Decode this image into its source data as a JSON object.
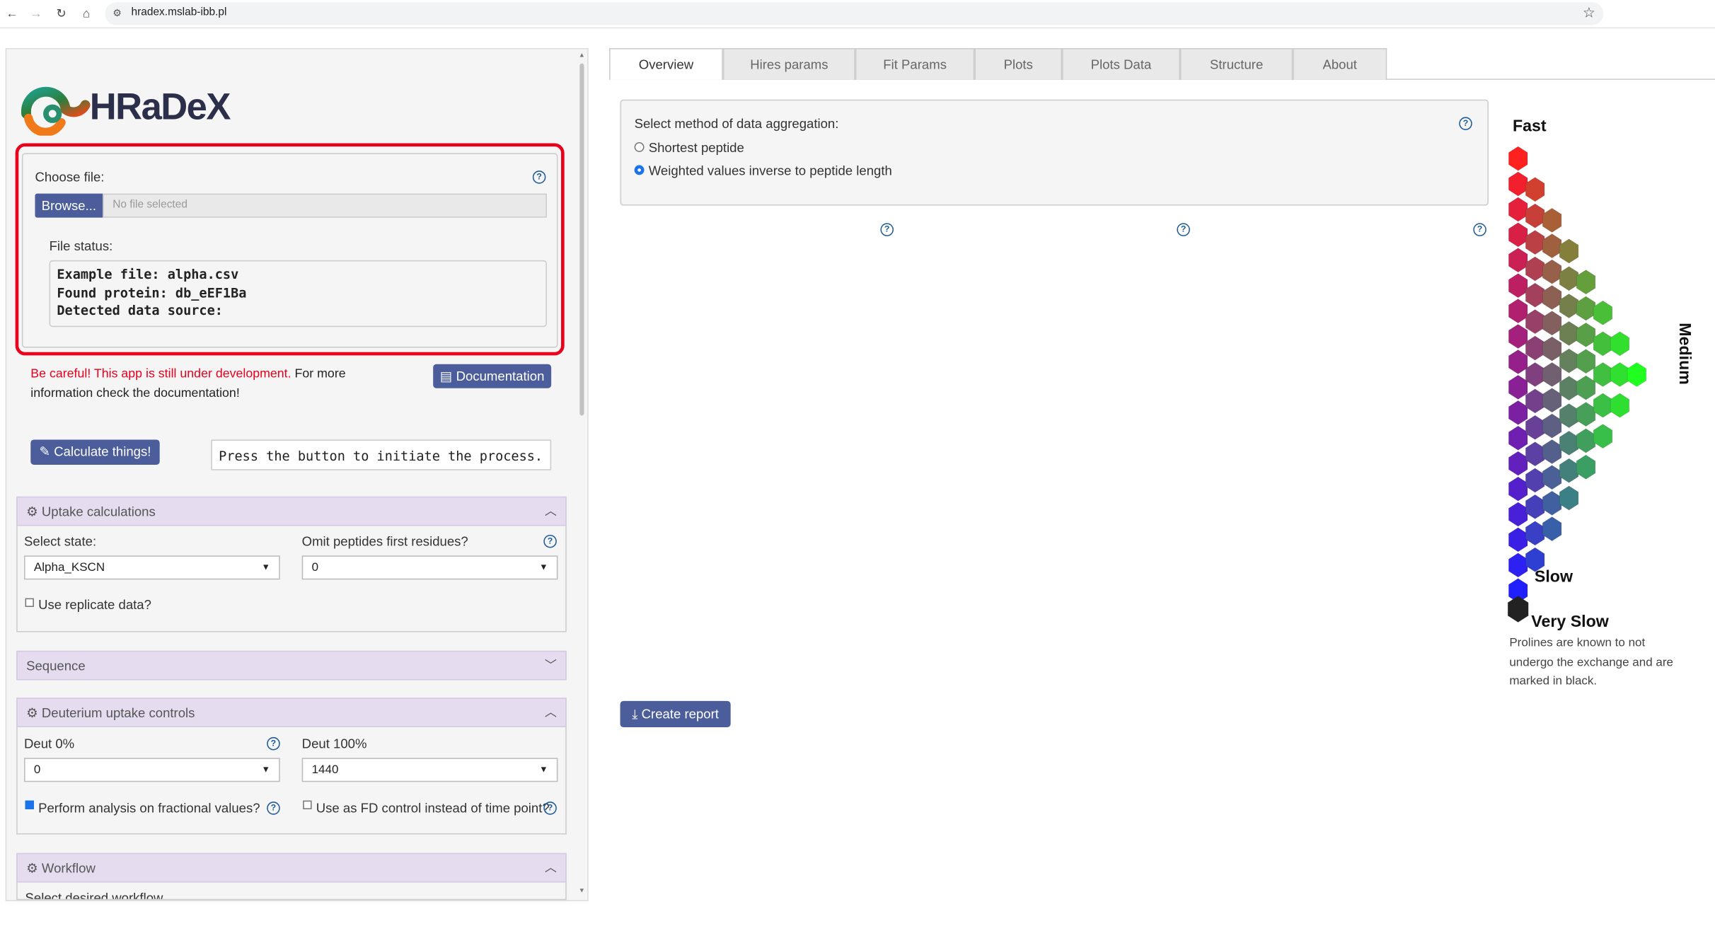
{
  "browser": {
    "url": "hradex.mslab-ibb.pl"
  },
  "app": {
    "logo": "HRaDeX"
  },
  "file_input": {
    "label": "Choose file:",
    "browse": "Browse...",
    "placeholder": "No file selected",
    "status_label": "File status:",
    "status_lines": [
      "Example file: alpha.csv",
      "Found protein: db_eEF1Ba",
      "Detected data source:"
    ]
  },
  "warning": {
    "red": "Be careful! This app is still under development.",
    "rest1": " For more",
    "rest2": "information check the documentation!"
  },
  "documentation_button": "Documentation",
  "calculate_button": "Calculate things!",
  "process_status": "Press the button to initiate the process.",
  "uptake": {
    "title": "Uptake calculations",
    "state_label": "Select state:",
    "state_value": "Alpha_KSCN",
    "omit_label": "Omit peptides first residues?",
    "omit_value": "0",
    "replicate_label": "Use replicate data?"
  },
  "sequence": {
    "title": "Sequence"
  },
  "deuterium": {
    "title": "Deuterium uptake controls",
    "deut0_label": "Deut 0%",
    "deut0_value": "0",
    "deut100_label": "Deut 100%",
    "deut100_value": "1440",
    "fractional_label": "Perform analysis on fractional values?",
    "fractional_checked": true,
    "fd_label": "Use as FD control instead of time point?",
    "fd_checked": false
  },
  "workflow": {
    "title": "Workflow",
    "sub": "Select desired workflow"
  },
  "tabs": [
    "Overview",
    "Hires params",
    "Fit Params",
    "Plots",
    "Plots Data",
    "Structure",
    "About"
  ],
  "active_tab": "Overview",
  "aggregation": {
    "label": "Select method of data aggregation:",
    "options": [
      "Shortest peptide",
      "Weighted values inverse to peptide length"
    ],
    "selected": 1
  },
  "create_report": "Create report",
  "legend": {
    "fast": "Fast",
    "medium": "Medium",
    "slow": "Slow",
    "very_slow": "Very Slow",
    "note_lines": [
      "Prolines are known to not",
      "undergo the exchange and are",
      "marked in black."
    ],
    "colors": {
      "fast": "#ff2020",
      "medium": "#20ff20",
      "slow": "#2020ff",
      "very_slow": "#222222"
    }
  }
}
